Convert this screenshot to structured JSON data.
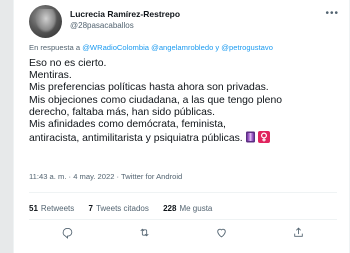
{
  "author": {
    "display_name": "Lucrecia Ramírez-Restrepo",
    "handle": "@28pasacaballos"
  },
  "reply": {
    "prefix": "En respuesta a",
    "mentions": "@WRadioColombia @angelamrobledo y @petrogustavo"
  },
  "tweet": {
    "lines": [
      "Eso no es cierto.",
      "Mentiras.",
      "Mis preferencias políticas hasta ahora son privadas.",
      "Mis objeciones como ciudadana, a las que tengo pleno",
      "derecho, faltaba más, han sido públicas.",
      "Mis afinidades como demócrata,  feminista,",
      "antiracista, antimilitarista y psiquiatra públicas."
    ]
  },
  "meta": {
    "time": "11:43 a. m.",
    "separator1": " · ",
    "date": "4 may. 2022",
    "separator2": " · ",
    "source": "Twitter for Android"
  },
  "stats": {
    "retweets_count": "51",
    "retweets_label": "Retweets",
    "quotes_count": "7",
    "quotes_label": "Tweets citados",
    "likes_count": "228",
    "likes_label": "Me gusta"
  },
  "icons": {
    "more": "more-options-icon",
    "reply": "reply-icon",
    "retweet": "retweet-icon",
    "like": "like-icon",
    "share": "share-icon",
    "emoji1": "purple-ribbon-emoji",
    "emoji2": "female-sign-emoji"
  },
  "colors": {
    "accent": "#1d9bf0",
    "text": "#0f1419",
    "secondary": "#536471",
    "female_sign": "#e0245e",
    "ribbon": "#7b3fa0"
  }
}
